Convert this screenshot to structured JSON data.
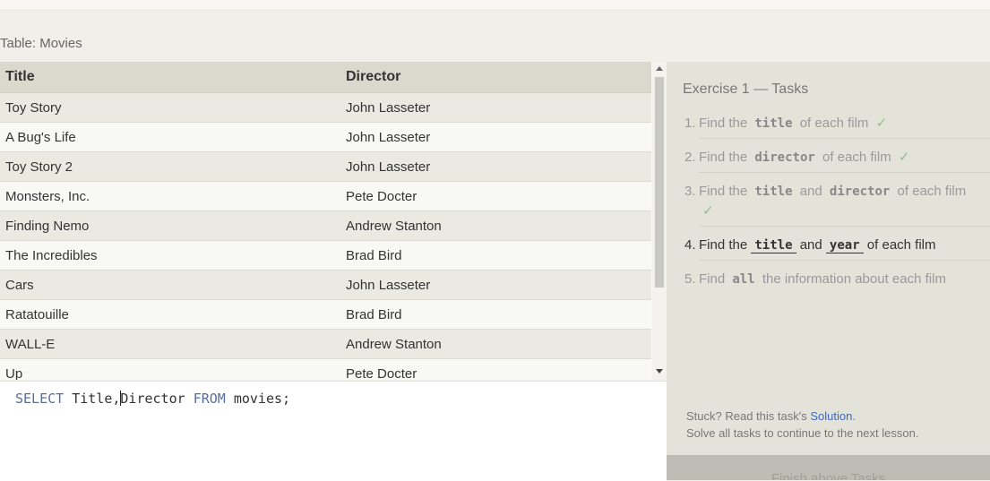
{
  "table_label": "Table: Movies",
  "columns": [
    "Title",
    "Director"
  ],
  "rows": [
    [
      "Toy Story",
      "John Lasseter"
    ],
    [
      "A Bug's Life",
      "John Lasseter"
    ],
    [
      "Toy Story 2",
      "John Lasseter"
    ],
    [
      "Monsters, Inc.",
      "Pete Docter"
    ],
    [
      "Finding Nemo",
      "Andrew Stanton"
    ],
    [
      "The Incredibles",
      "Brad Bird"
    ],
    [
      "Cars",
      "John Lasseter"
    ],
    [
      "Ratatouille",
      "Brad Bird"
    ],
    [
      "WALL-E",
      "Andrew Stanton"
    ],
    [
      "Up",
      "Pete Docter"
    ]
  ],
  "editor": {
    "kw1": "SELECT",
    "part1": " Title,",
    "part2": "Director ",
    "kw2": "FROM",
    "part3": " movies;"
  },
  "exercise": {
    "title": "Exercise 1 — Tasks",
    "tasks": [
      {
        "num": "1.",
        "pre": "Find the",
        "code1": "title",
        "mid": "",
        "code2": "",
        "post": "of each film",
        "check": "✓"
      },
      {
        "num": "2.",
        "pre": "Find the",
        "code1": "director",
        "mid": "",
        "code2": "",
        "post": "of each film",
        "check": "✓"
      },
      {
        "num": "3.",
        "pre": "Find the",
        "code1": "title",
        "mid": "and",
        "code2": "director",
        "post": "of each film",
        "check": "✓"
      },
      {
        "num": "4.",
        "pre": "Find the",
        "code1": "title",
        "mid": "and",
        "code2": "year",
        "post": "of each film",
        "check": ""
      },
      {
        "num": "5.",
        "pre": "Find",
        "code1": "all",
        "mid": "",
        "code2": "",
        "post": "the information about each film",
        "check": ""
      }
    ],
    "stuck_prefix": "Stuck? Read this task's",
    "solution_link": "Solution",
    "stuck_suffix": ".",
    "continue_text": "Solve all tasks to continue to the next lesson.",
    "finish_label": "Finish above Tasks"
  },
  "colors": {
    "keyword": "#5a6e9c",
    "link": "#3a67c0",
    "check": "#8fbf8f"
  }
}
